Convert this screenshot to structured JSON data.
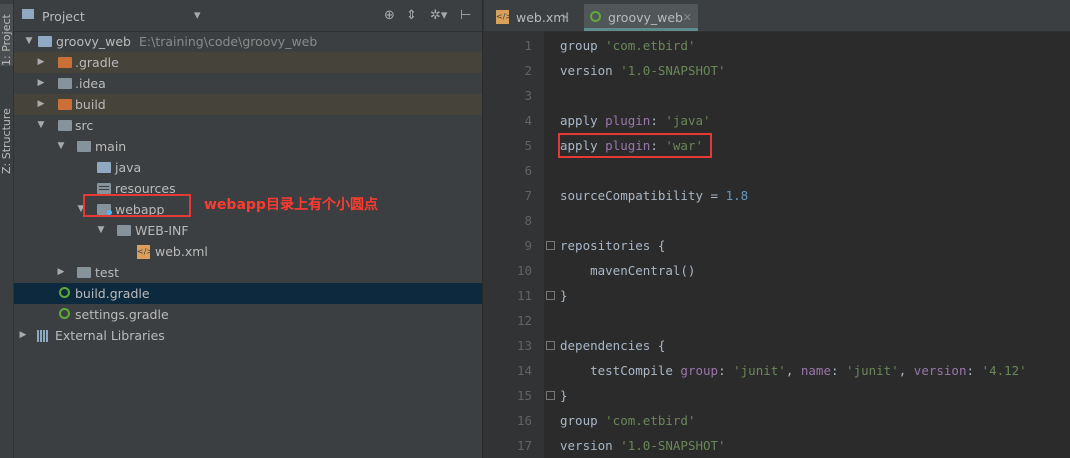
{
  "strip": {
    "project_tab": "1: Project",
    "structure_tab": "Z: Structure"
  },
  "project_panel": {
    "title": "Project",
    "tree": [
      {
        "label": "groovy_web",
        "path": "E:\\training\\code\\groovy_web"
      },
      {
        "label": ".gradle"
      },
      {
        "label": ".idea"
      },
      {
        "label": "build"
      },
      {
        "label": "src"
      },
      {
        "label": "main"
      },
      {
        "label": "java"
      },
      {
        "label": "resources"
      },
      {
        "label": "webapp"
      },
      {
        "label": "WEB-INF"
      },
      {
        "label": "web.xml"
      },
      {
        "label": "test"
      },
      {
        "label": "build.gradle"
      },
      {
        "label": "settings.gradle"
      },
      {
        "label": "External Libraries"
      }
    ],
    "annotation": "webapp目录上有个小圆点"
  },
  "editor": {
    "tabs": [
      {
        "label": "web.xml"
      },
      {
        "label": "groovy_web",
        "active": true
      }
    ],
    "line_numbers": [
      "1",
      "2",
      "3",
      "4",
      "5",
      "6",
      "7",
      "8",
      "9",
      "10",
      "11",
      "12",
      "13",
      "14",
      "15",
      "16",
      "17"
    ],
    "lines": [
      [
        "group ",
        "'com.etbird'"
      ],
      [
        "version ",
        "'1.0-SNAPSHOT'"
      ],
      [],
      [
        "apply ",
        "plugin",
        ": ",
        "'java'"
      ],
      [
        "apply ",
        "plugin",
        ": ",
        "'war'"
      ],
      [],
      [
        "sourceCompatibility = ",
        "1.8"
      ],
      [],
      [
        "repositories {"
      ],
      [
        "    mavenCentral()"
      ],
      [
        "}"
      ],
      [],
      [
        "dependencies {"
      ],
      [
        "    testCompile ",
        "group",
        ": ",
        "'junit'",
        ", ",
        "name",
        ": ",
        "'junit'",
        ", ",
        "version",
        ": ",
        "'4.12'"
      ],
      [
        "}"
      ],
      [
        "group ",
        "'com.etbird'"
      ],
      [
        "version ",
        "'1.0-SNAPSHOT'"
      ]
    ]
  },
  "colors": {
    "annotation_red": "#e53935",
    "selection": "#0d293e",
    "string": "#6a8759",
    "number": "#6897bb",
    "named_arg": "#9876aa"
  },
  "icons": [
    "project-icon",
    "target-icon",
    "collapse-icon",
    "gear-icon",
    "hide-icon",
    "folder-icon",
    "gradle-icon",
    "xml-file-icon",
    "library-icon",
    "close-icon"
  ]
}
